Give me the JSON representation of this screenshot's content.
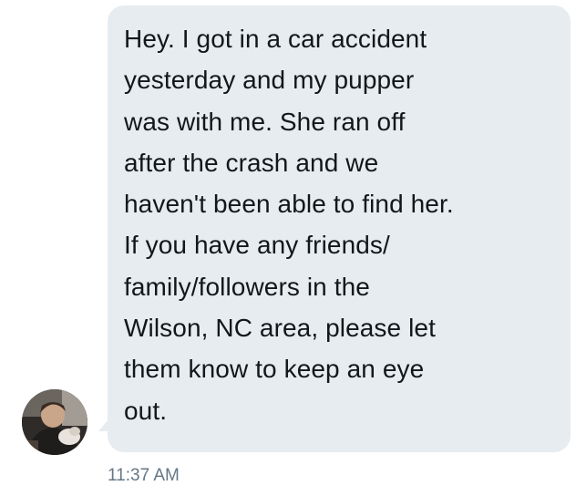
{
  "message": {
    "text": "Hey. I got in a car accident\nyesterday and my pupper\nwas with me. She ran off\nafter the crash and we\nhaven't been able to find her.\nIf you have any friends/\nfamily/followers in the\nWilson, NC area, please let\nthem know to keep an eye\nout.",
    "timestamp": "11:37 AM"
  },
  "sender": {
    "avatar_icon": "user-avatar-photo"
  },
  "colors": {
    "bubble_background": "#e6ecf0",
    "message_text": "#14171a",
    "timestamp_text": "#657786"
  }
}
